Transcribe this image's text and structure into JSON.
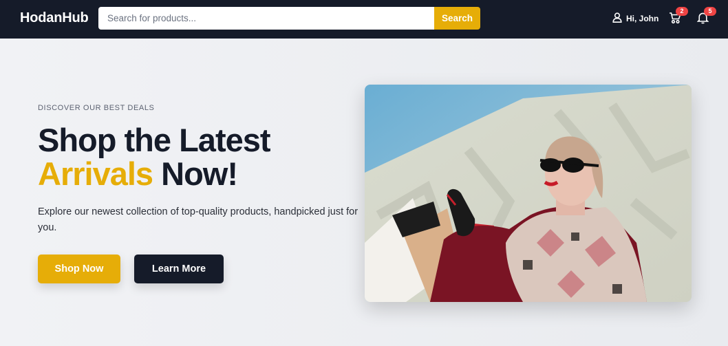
{
  "navbar": {
    "logo": "HodanHub",
    "search": {
      "placeholder": "Search for products...",
      "button_label": "Search"
    },
    "user": {
      "greeting": "Hi, John",
      "icon": "user-icon"
    },
    "cart": {
      "icon": "cart-icon",
      "count": "2"
    },
    "notifications": {
      "icon": "bell-icon",
      "count": "5"
    }
  },
  "hero": {
    "eyebrow": "DISCOVER OUR BEST DEALS",
    "headline_line1": "Shop the Latest",
    "headline_accent": "Arrivals",
    "headline_rest": "Now!",
    "description": "Explore our newest collection of top-quality products, handpicked just for you.",
    "primary_button": "Shop Now",
    "secondary_button": "Learn More",
    "image": "photo of woman in sunglasses holding shopping bags"
  },
  "colors": {
    "navbar_bg": "#151b29",
    "accent": "#e6ad08",
    "badge": "#ef4444",
    "dark_button": "#151b29"
  }
}
